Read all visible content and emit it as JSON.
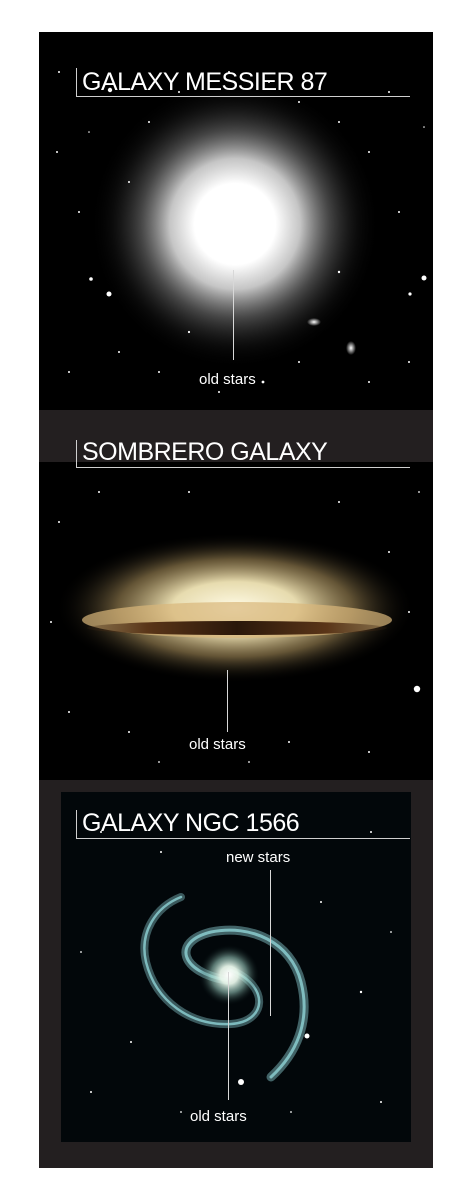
{
  "panels": [
    {
      "title": "GALAXY MESSIER 87",
      "labels": [
        "old stars"
      ]
    },
    {
      "title": "SOMBRERO GALAXY",
      "labels": [
        "old stars"
      ]
    },
    {
      "title": "GALAXY NGC 1566",
      "labels": [
        "new stars",
        "old stars"
      ]
    }
  ],
  "colors": {
    "frame": "#231f20",
    "space": "#000000",
    "text": "#ffffff",
    "rule": "#cfcfcf"
  }
}
